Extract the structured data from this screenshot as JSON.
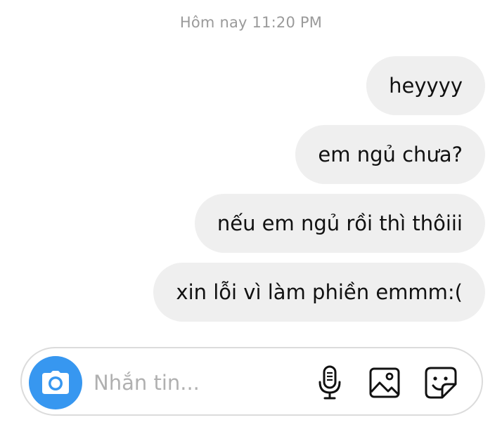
{
  "conversation": {
    "timestamp": "Hôm nay 11:20 PM",
    "messages": [
      {
        "text": "heyyyy",
        "sender": "me"
      },
      {
        "text": "em ngủ chưa?",
        "sender": "me"
      },
      {
        "text": "nếu em ngủ rồi thì thôiii",
        "sender": "me"
      },
      {
        "text": "xin lỗi vì làm phiền emmm:(",
        "sender": "me"
      }
    ]
  },
  "composer": {
    "placeholder": "Nhắn tin...",
    "value": "",
    "icons": {
      "camera": "camera-icon",
      "mic": "microphone-icon",
      "gallery": "gallery-icon",
      "sticker": "sticker-icon"
    }
  },
  "colors": {
    "accent": "#3797f0",
    "bubble": "#efefef",
    "timestamp": "#9a9a9a",
    "placeholder": "#b0b0b0"
  }
}
